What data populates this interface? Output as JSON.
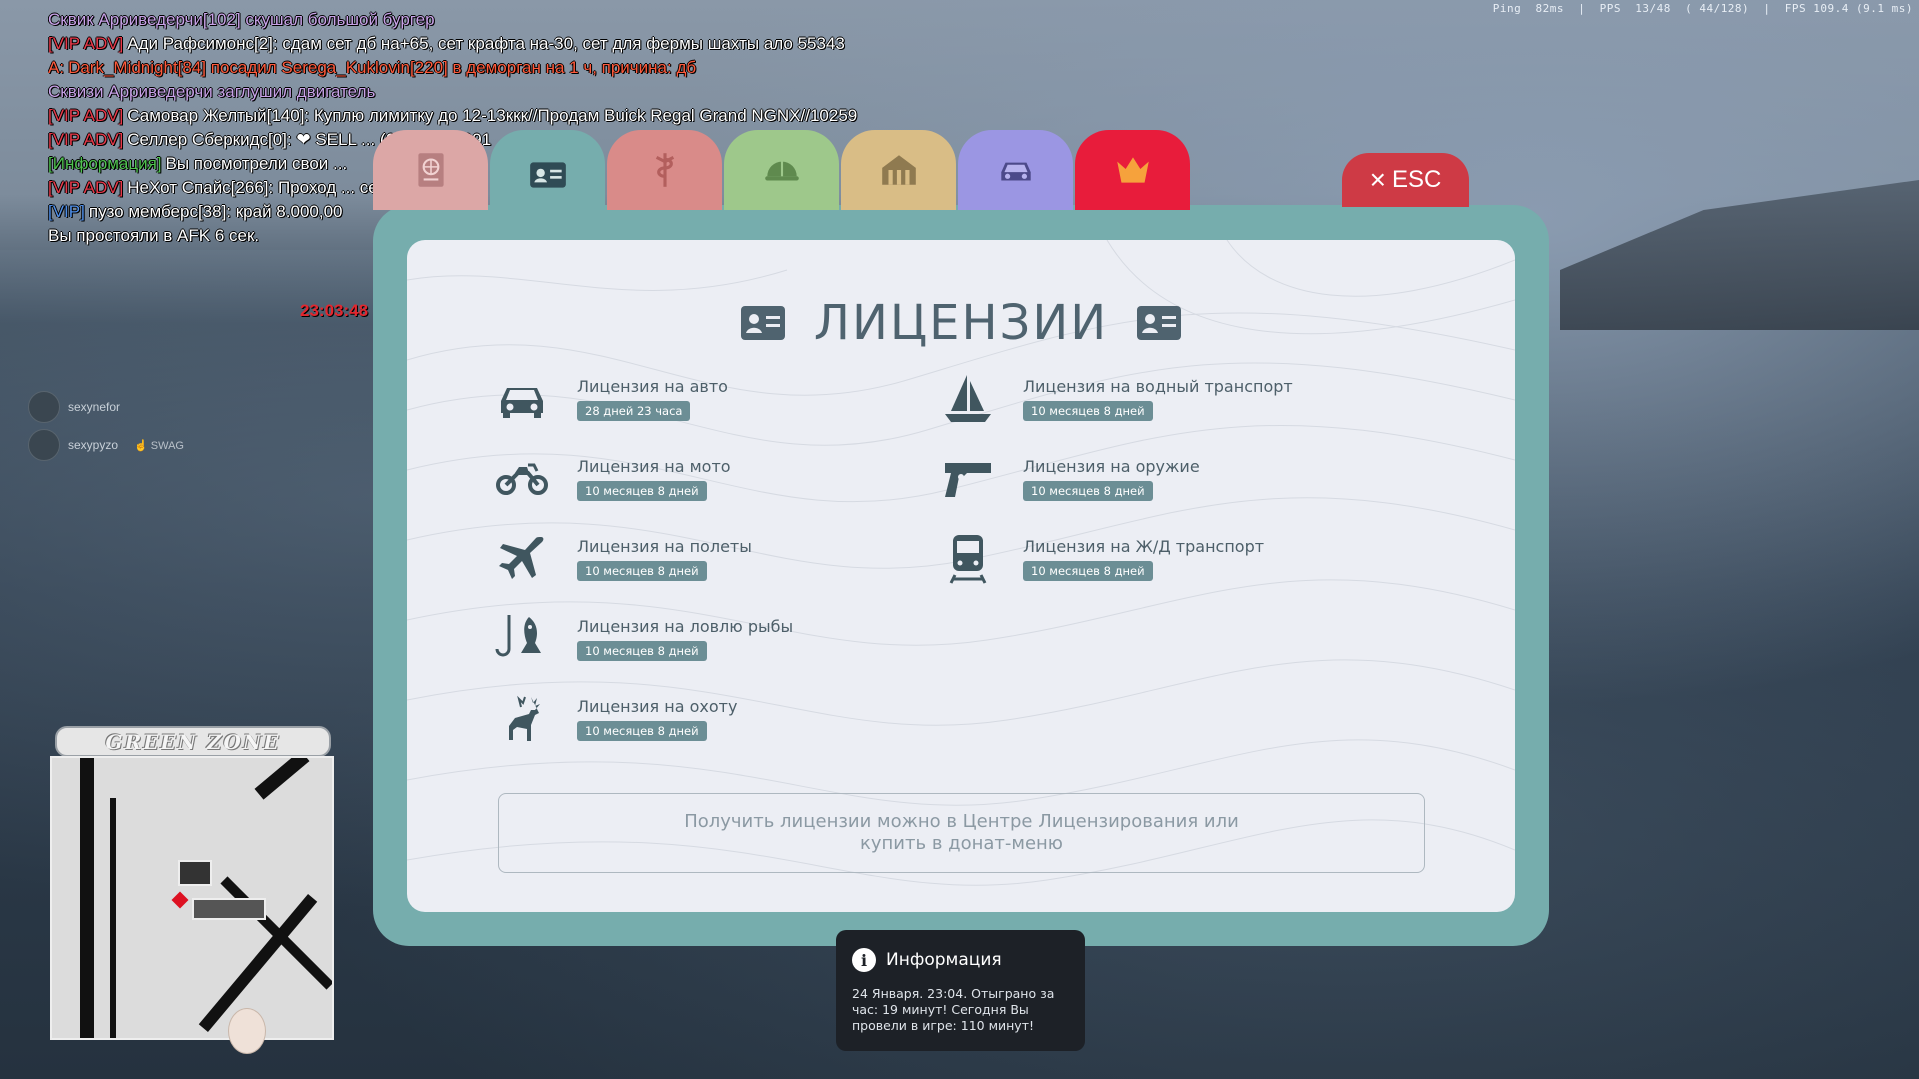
{
  "hud": {
    "perf": "Ping  82ms  |  PPS  13/48  ( 44/128)  |  FPS 109.4 (9.1 ms)",
    "clock": "23:03:48"
  },
  "chat": [
    {
      "tag": "",
      "tag_color": "#c8a2e8",
      "text": "Сквик Арриведерчи[102] скушал большой бургер",
      "color": "#c8a2e8"
    },
    {
      "tag": "[VIP ADV]",
      "tag_color": "#e8394a",
      "text": "Ади Рафсимонс[2]: сдам сет дб на+65, сет крафта на-30, сет для фермы шахты ало 55343",
      "color": "#ffffff"
    },
    {
      "tag": "A:",
      "tag_color": "#ff5a3c",
      "text": "Dark_Midnight[84] посадил Serega_Kuklovin[220] в деморган на 1 ч, причина: дб",
      "color": "#ff5a3c"
    },
    {
      "tag": "",
      "tag_color": "#c8a2e8",
      "text": " Сквизи Арриведерчи заглушил двигатель",
      "color": "#c8a2e8"
    },
    {
      "tag": "[VIP ADV]",
      "tag_color": "#e8394a",
      "text": "Самовар Желтый[140]: Куплю лимитку до 12-13ккк//Продам Buick Regal Grand NGNX//10259",
      "color": "#ffffff"
    },
    {
      "tag": "[VIP ADV]",
      "tag_color": "#e8394a",
      "text": "Селлер Сберкидс[0]: ❤ SELL ... (6) ТЕЛ-19991",
      "color": "#ffffff"
    },
    {
      "tag": "[Информация]",
      "tag_color": "#4fc24f",
      "text": "Вы посмотрели свои ...",
      "color": "#ffffff"
    },
    {
      "tag": "[VIP ADV]",
      "tag_color": "#e8394a",
      "text": "НеХот Спайс[266]: Проход ... семья",
      "color": "#ffffff"
    },
    {
      "tag": "[VIP]",
      "tag_color": "#4f8fe8",
      "text": "пузо мемберс[38]: край 8.000,00",
      "color": "#ffffff"
    },
    {
      "tag": "",
      "tag_color": "#ffffff",
      "text": "Вы простояли в AFK 6 сек.",
      "color": "#ffffff"
    }
  ],
  "voice": [
    {
      "name": "sexynefor",
      "tag": ""
    },
    {
      "name": "sexypyzo",
      "tag": "☝ SWAG"
    }
  ],
  "zone": "GREEN ZONE",
  "tabs": [
    {
      "icon": "passport-icon",
      "color": "#dca7a6"
    },
    {
      "icon": "id-card-icon",
      "color": "#76adad"
    },
    {
      "icon": "medical-icon",
      "color": "#d98b89"
    },
    {
      "icon": "helmet-icon",
      "color": "#9ec88b"
    },
    {
      "icon": "house-icon",
      "color": "#d9bd86"
    },
    {
      "icon": "car-icon",
      "color": "#9b96e3"
    },
    {
      "icon": "crown-icon",
      "color": "#e81c3b"
    }
  ],
  "esc_label": "ESC",
  "title": "ЛИЦЕНЗИИ",
  "licenses": [
    {
      "name": "Лицензия на авто",
      "duration": "28 дней 23 часа",
      "icon": "car-icon"
    },
    {
      "name": "Лицензия на мото",
      "duration": "10 месяцев 8 дней",
      "icon": "motorcycle-icon"
    },
    {
      "name": "Лицензия на полеты",
      "duration": "10 месяцев 8 дней",
      "icon": "airplane-icon"
    },
    {
      "name": "Лицензия на ловлю рыбы",
      "duration": "10 месяцев 8 дней",
      "icon": "fish-icon"
    },
    {
      "name": "Лицензия на охоту",
      "duration": "10 месяцев 8 дней",
      "icon": "deer-icon"
    },
    {
      "name": "Лицензия на водный транспорт",
      "duration": "10 месяцев 8 дней",
      "icon": "sailboat-icon"
    },
    {
      "name": "Лицензия на оружие",
      "duration": "10 месяцев 8 дней",
      "icon": "pistol-icon"
    },
    {
      "name": "Лицензия на Ж/Д транспорт",
      "duration": "10 месяцев 8 дней",
      "icon": "train-icon"
    }
  ],
  "hint": "Получить лицензии можно в Центре Лицензирования или купить в донат-меню",
  "info": {
    "title": "Информация",
    "body": "24 Января. 23:04. Отыграно за час: 19 минут! Сегодня Вы провели в игре: 110 минут!"
  },
  "colors": {
    "frame": "#76adad",
    "panel": "#eceef4",
    "icon": "#40565f",
    "badge": "#6c8e95",
    "esc": "#ce3a45"
  }
}
